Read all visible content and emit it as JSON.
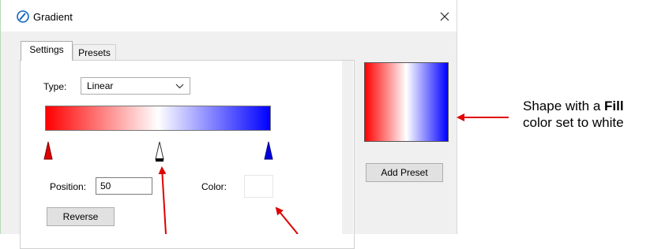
{
  "window": {
    "title": "Gradient",
    "close_icon": "close-icon",
    "app_icon": "pen-circle-icon"
  },
  "tabs": [
    {
      "label": "Settings",
      "active": true
    },
    {
      "label": "Presets",
      "active": false
    }
  ],
  "settings": {
    "type_label": "Type:",
    "type_value": "Linear",
    "gradient": {
      "start_color": "#ff0000",
      "mid_color": "#ffffff",
      "end_color": "#0000ff"
    },
    "stops": [
      {
        "color": "#ff0000",
        "position_pct": 0
      },
      {
        "color": "#ffffff",
        "position_pct": 50,
        "selected": true
      },
      {
        "color": "#0000ff",
        "position_pct": 100
      }
    ],
    "position_label": "Position:",
    "position_value": "50",
    "color_label": "Color:",
    "color_value": "#ffffff",
    "reverse_label": "Reverse"
  },
  "preview": {
    "add_preset_label": "Add Preset"
  },
  "annotation": {
    "line1_pre": "Shape with a ",
    "line1_bold": "Fill",
    "line2": "color set to white",
    "arrow_color": "#ff0000"
  }
}
